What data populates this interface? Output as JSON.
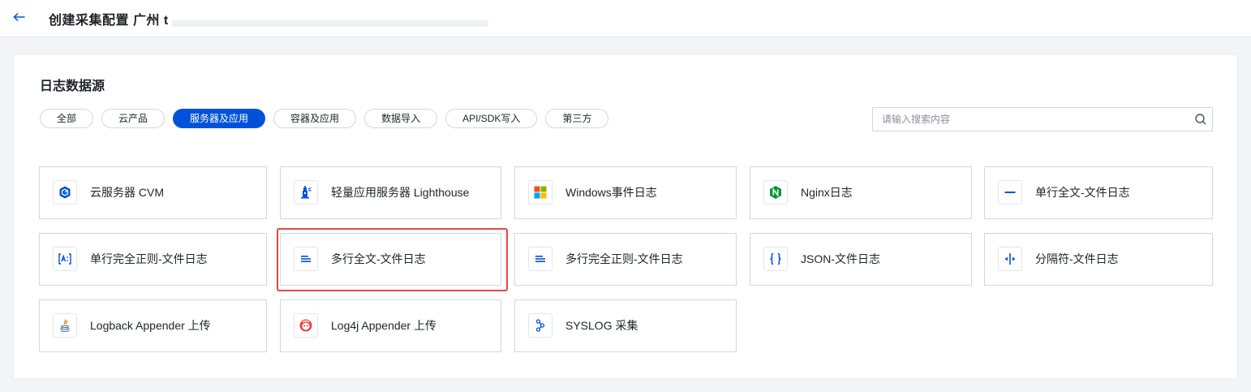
{
  "header": {
    "title": "创建采集配置 广州 t"
  },
  "section": {
    "title": "日志数据源"
  },
  "filters": [
    {
      "label": "全部",
      "active": false
    },
    {
      "label": "云产品",
      "active": false
    },
    {
      "label": "服务器及应用",
      "active": true
    },
    {
      "label": "容器及应用",
      "active": false
    },
    {
      "label": "数据导入",
      "active": false
    },
    {
      "label": "API/SDK写入",
      "active": false
    },
    {
      "label": "第三方",
      "active": false
    }
  ],
  "search": {
    "placeholder": "请输入搜索内容",
    "value": ""
  },
  "sources": [
    {
      "label": "云服务器 CVM",
      "icon": "cvm-icon"
    },
    {
      "label": "轻量应用服务器 Lighthouse",
      "icon": "lighthouse-icon"
    },
    {
      "label": "Windows事件日志",
      "icon": "windows-icon"
    },
    {
      "label": "Nginx日志",
      "icon": "nginx-icon"
    },
    {
      "label": "单行全文-文件日志",
      "icon": "single-line-icon"
    },
    {
      "label": "单行完全正则-文件日志",
      "icon": "regex-icon"
    },
    {
      "label": "多行全文-文件日志",
      "icon": "multi-line-icon",
      "highlighted": true
    },
    {
      "label": "多行完全正则-文件日志",
      "icon": "multi-line-regex-icon"
    },
    {
      "label": "JSON-文件日志",
      "icon": "json-icon"
    },
    {
      "label": "分隔符-文件日志",
      "icon": "delimiter-icon"
    },
    {
      "label": "Logback Appender 上传",
      "icon": "java-icon"
    },
    {
      "label": "Log4j Appender 上传",
      "icon": "log4j-icon"
    },
    {
      "label": "SYSLOG 采集",
      "icon": "syslog-icon"
    }
  ],
  "colors": {
    "accent": "#0052d9",
    "highlight_border": "#e54545"
  }
}
